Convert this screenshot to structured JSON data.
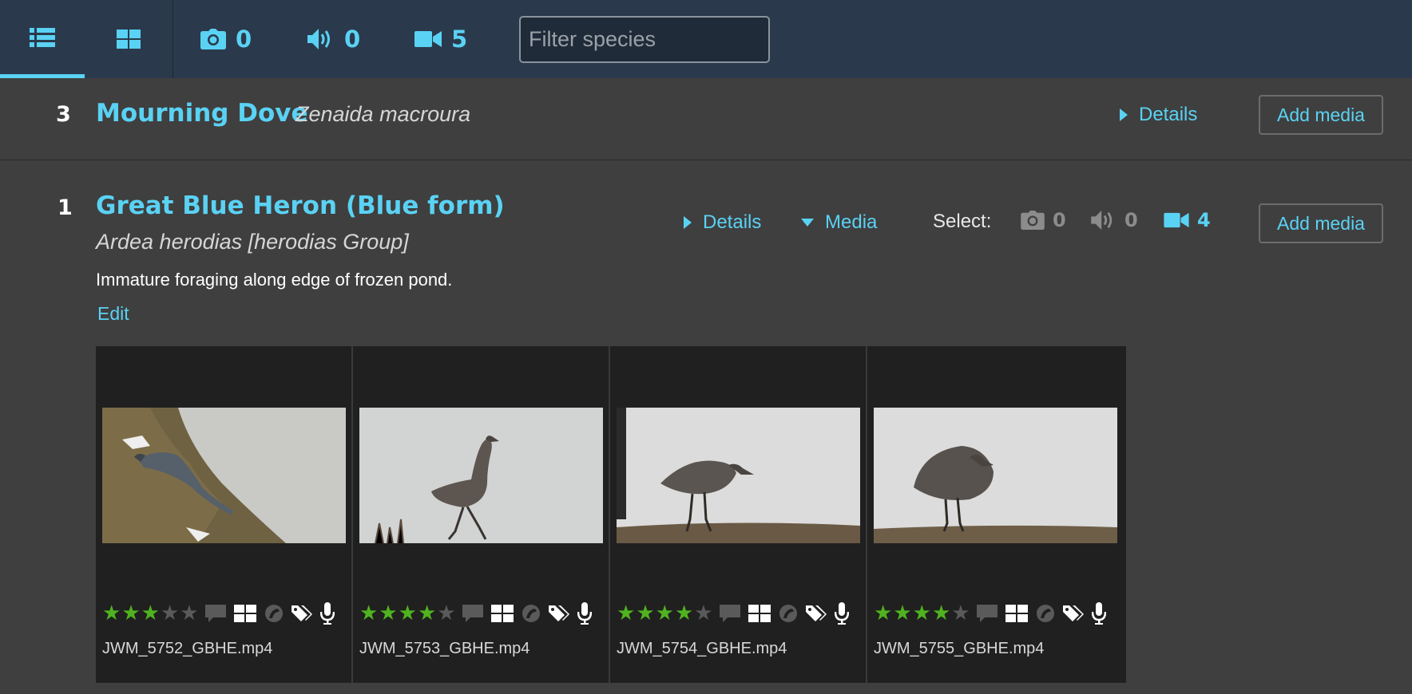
{
  "colors": {
    "accent": "#5ad2f4",
    "topbar": "#2a3a4c",
    "background": "#3f3f3f",
    "star_on": "#4fb31f"
  },
  "toolbar": {
    "list_view_icon": "list-icon",
    "grid_view_icon": "grid-icon",
    "photo_count": "0",
    "audio_count": "0",
    "video_count": "5",
    "filter_placeholder": "Filter species"
  },
  "species": [
    {
      "count": "3",
      "common_name": "Mourning Dove",
      "scientific_name": "Zenaida macroura",
      "details_label": "Details",
      "add_media_label": "Add media"
    },
    {
      "count": "1",
      "common_name": "Great Blue Heron (Blue form)",
      "scientific_name": "Ardea herodias [herodias Group]",
      "details_label": "Details",
      "media_label": "Media",
      "select_label": "Select:",
      "select_photo": "0",
      "select_audio": "0",
      "select_video": "4",
      "add_media_label": "Add media",
      "comment": "Immature foraging along edge of frozen pond.",
      "edit_label": "Edit",
      "media": [
        {
          "filename": "JWM_5752_GBHE.mp4",
          "rating": 3
        },
        {
          "filename": "JWM_5753_GBHE.mp4",
          "rating": 4
        },
        {
          "filename": "JWM_5754_GBHE.mp4",
          "rating": 4
        },
        {
          "filename": "JWM_5755_GBHE.mp4",
          "rating": 4
        }
      ]
    }
  ]
}
